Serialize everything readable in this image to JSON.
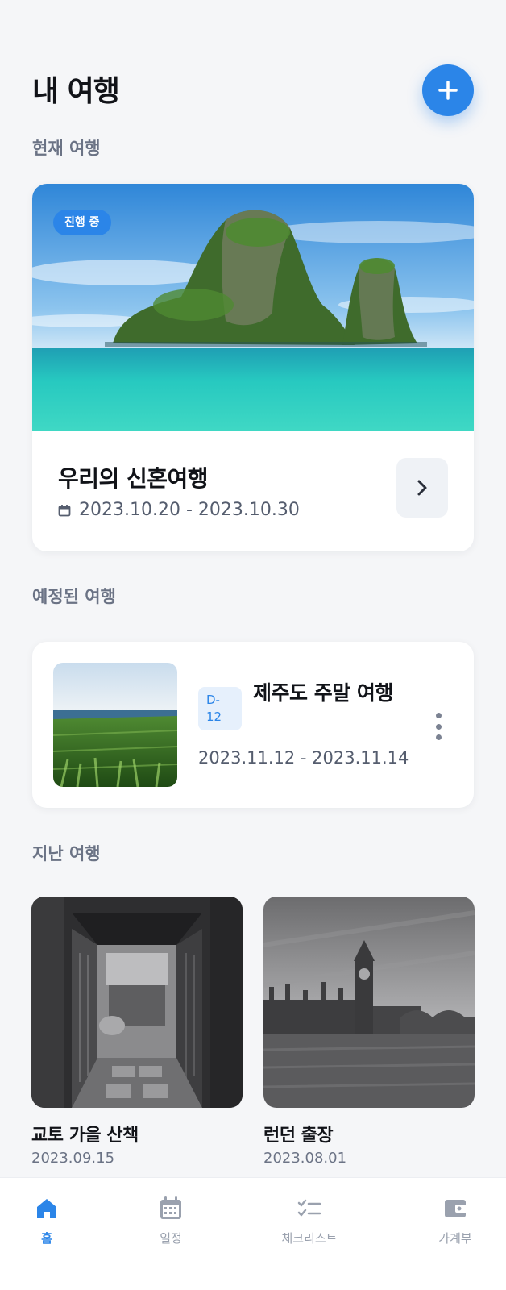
{
  "header": {
    "title": "내 여행",
    "add_icon": "plus-icon"
  },
  "current": {
    "section_title": "현재 여행",
    "badge": "진행 중",
    "title": "우리의 신혼여행",
    "dates": "2023.10.20 - 2023.10.30",
    "calendar_icon": "calendar-icon",
    "arrow_icon": "chevron-right-icon"
  },
  "upcoming": {
    "section_title": "예정된 여행",
    "dday": "D-12",
    "title": "제주도 주말 여행",
    "dates": "2023.11.12 - 2023.11.14",
    "more_icon": "more-vertical-icon"
  },
  "past": {
    "section_title": "지난 여행",
    "items": [
      {
        "title": "교토 가을 산책",
        "date": "2023.09.15"
      },
      {
        "title": "런던 출장",
        "date": "2023.08.01"
      }
    ]
  },
  "nav": {
    "items": [
      {
        "label": "홈",
        "icon": "home-icon",
        "active": true
      },
      {
        "label": "일정",
        "icon": "calendar-grid-icon",
        "active": false
      },
      {
        "label": "체크리스트",
        "icon": "checklist-icon",
        "active": false
      },
      {
        "label": "가계부",
        "icon": "wallet-icon",
        "active": false
      }
    ]
  },
  "colors": {
    "accent": "#2b85e8",
    "background": "#f5f6f8",
    "muted": "#6b7385"
  }
}
